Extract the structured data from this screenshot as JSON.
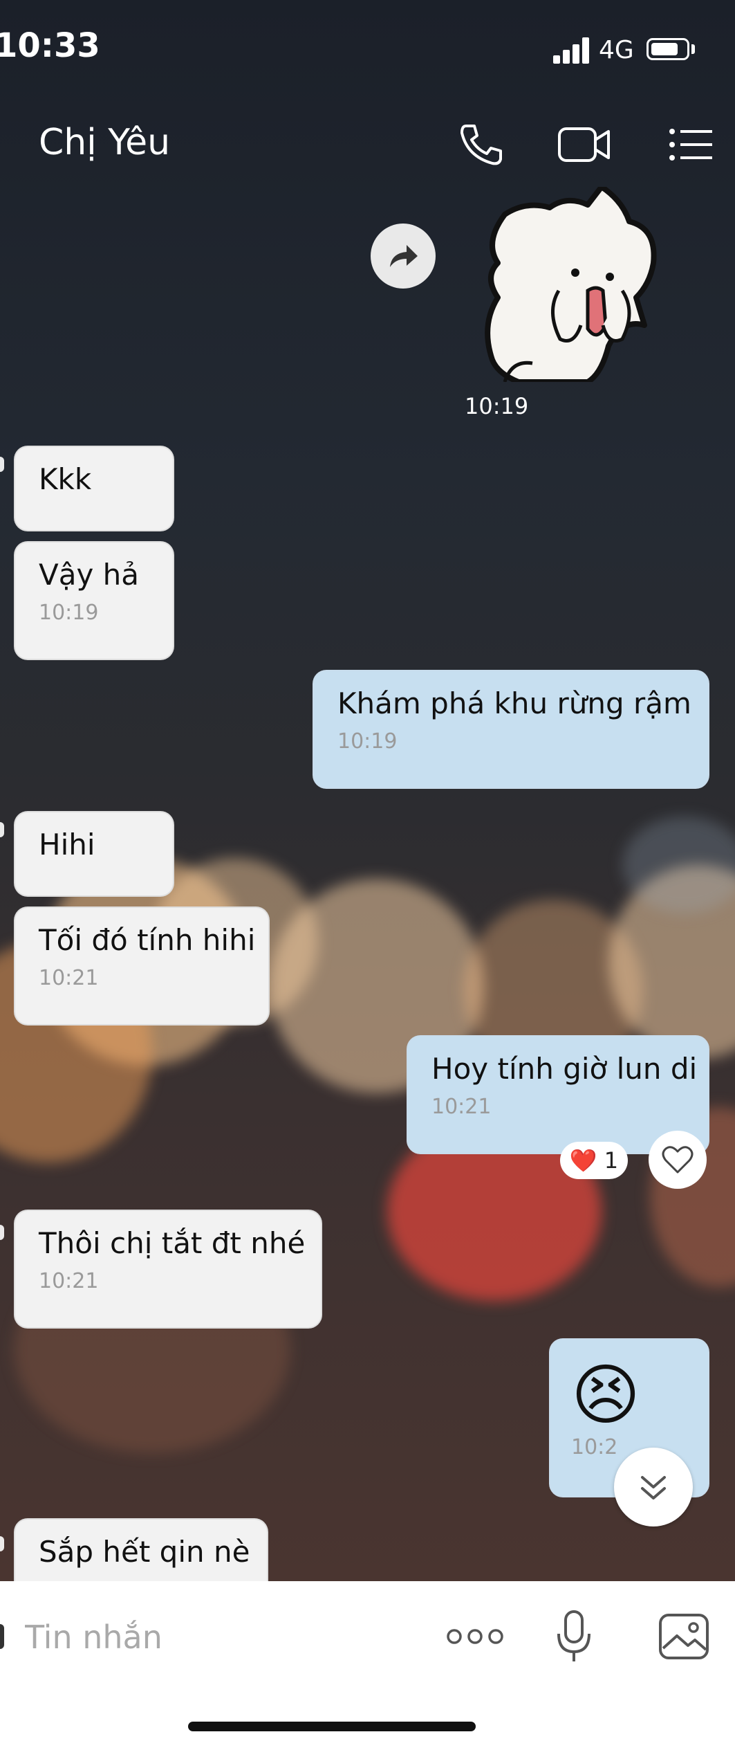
{
  "status": {
    "time": "10:33",
    "network": "4G",
    "battery_level": 0.75
  },
  "header": {
    "title": "Chị Yêu",
    "icons": [
      "phone-icon",
      "video-camera-icon",
      "menu-list-icon"
    ]
  },
  "sticker": {
    "time": "10:19"
  },
  "messages": [
    {
      "dir": "in",
      "text": "Kkk",
      "time": ""
    },
    {
      "dir": "in",
      "text": "Vậy hả",
      "time": "10:19"
    },
    {
      "dir": "out",
      "text": "Khám phá khu rừng rậm",
      "time": "10:19"
    },
    {
      "dir": "in",
      "text": "Hihi",
      "time": ""
    },
    {
      "dir": "in",
      "text": "Tối đó tính hihi",
      "time": "10:21"
    },
    {
      "dir": "out",
      "text": "Hoy tính giờ lun di",
      "time": "10:21"
    },
    {
      "dir": "in",
      "text": "Thôi chị tắt đt nhé",
      "time": "10:21"
    },
    {
      "dir": "out",
      "text": "😣",
      "time": "10:2"
    },
    {
      "dir": "in",
      "text": "Sắp hết qin nè",
      "time": ""
    }
  ],
  "reaction": {
    "emoji": "❤️",
    "count": "1"
  },
  "composer": {
    "placeholder": "Tin nhắn"
  },
  "colors": {
    "incoming": "#f2f2f2",
    "outgoing": "#c7dff0",
    "heart": "#e8333a"
  }
}
